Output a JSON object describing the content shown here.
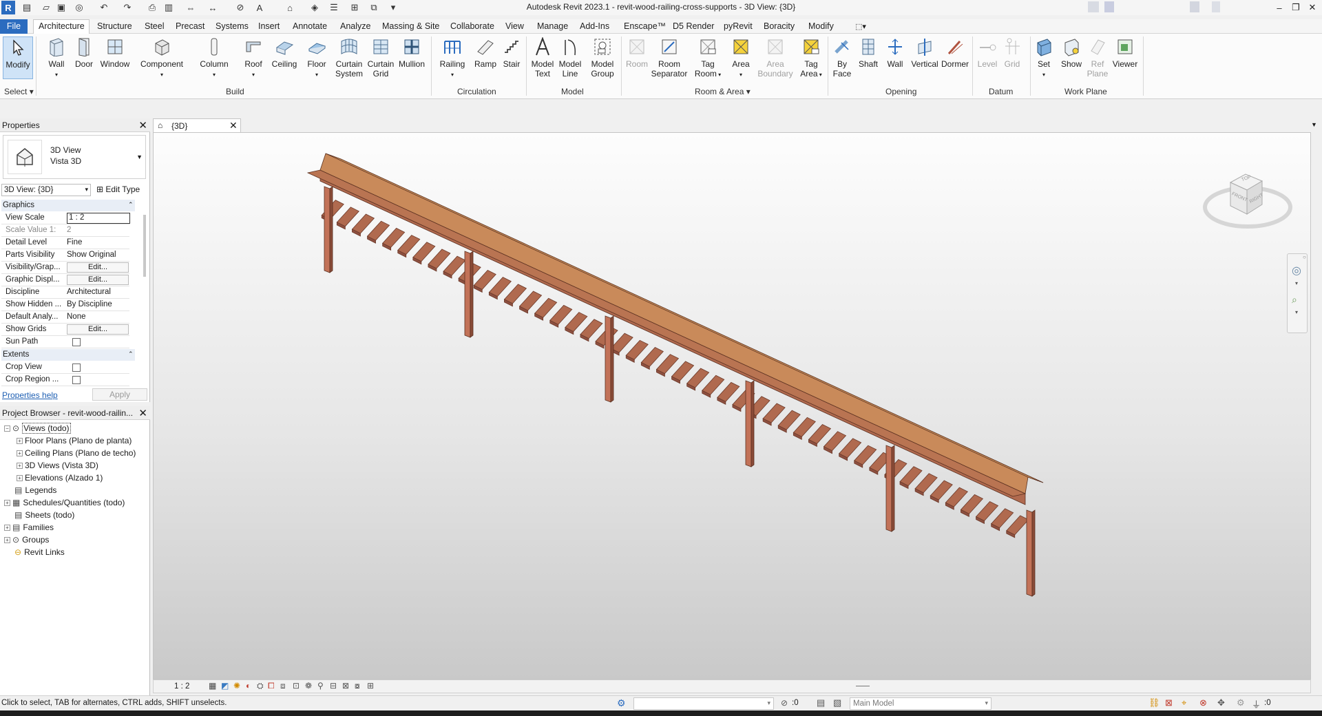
{
  "app": {
    "title": "Autodesk Revit 2023.1 - revit-wood-railing-cross-supports - 3D View: {3D}"
  },
  "menu": {
    "file": "File",
    "tabs": [
      "Architecture",
      "Structure",
      "Steel",
      "Precast",
      "Systems",
      "Insert",
      "Annotate",
      "Analyze",
      "Massing & Site",
      "Collaborate",
      "View",
      "Manage",
      "Add-Ins",
      "Enscape™",
      "D5 Render",
      "pyRevit",
      "Boracity",
      "Modify"
    ],
    "active_tab": "Architecture"
  },
  "ribbon": {
    "select": {
      "modify": "Modify",
      "select_label": "Select"
    },
    "build": {
      "label": "Build",
      "wall": "Wall",
      "door": "Door",
      "window": "Window",
      "component": "Component",
      "column": "Column",
      "roof": "Roof",
      "ceiling": "Ceiling",
      "floor": "Floor",
      "curtain_system_1": "Curtain",
      "curtain_system_2": "System",
      "curtain_grid_1": "Curtain",
      "curtain_grid_2": "Grid",
      "mullion": "Mullion"
    },
    "circulation": {
      "label": "Circulation",
      "railing": "Railing",
      "ramp": "Ramp",
      "stair": "Stair"
    },
    "model": {
      "label": "Model",
      "model_text_1": "Model",
      "model_text_2": "Text",
      "model_line_1": "Model",
      "model_line_2": "Line",
      "model_group_1": "Model",
      "model_group_2": "Group"
    },
    "room_area": {
      "label": "Room & Area",
      "room": "Room",
      "room_sep_1": "Room",
      "room_sep_2": "Separator",
      "tag_room_1": "Tag",
      "tag_room_2": "Room",
      "area": "Area",
      "area_boundary_1": "Area",
      "area_boundary_2": "Boundary",
      "tag_area_1": "Tag",
      "tag_area_2": "Area"
    },
    "opening": {
      "label": "Opening",
      "by_face_1": "By",
      "by_face_2": "Face",
      "shaft": "Shaft",
      "wall": "Wall",
      "vertical": "Vertical",
      "dormer": "Dormer"
    },
    "datum": {
      "label": "Datum",
      "level": "Level",
      "grid": "Grid"
    },
    "work_plane": {
      "label": "Work Plane",
      "set": "Set",
      "show": "Show",
      "ref_plane_1": "Ref",
      "ref_plane_2": "Plane",
      "viewer": "Viewer"
    }
  },
  "properties": {
    "header": "Properties",
    "type_1": "3D View",
    "type_2": "Vista 3D",
    "selector": "3D View: {3D}",
    "edit_type": "Edit Type",
    "group_graphics": "Graphics",
    "rows": [
      {
        "k": "View Scale",
        "v": "1 : 2"
      },
      {
        "k": "Scale Value    1:",
        "v": "2"
      },
      {
        "k": "Detail Level",
        "v": "Fine"
      },
      {
        "k": "Parts Visibility",
        "v": "Show Original"
      },
      {
        "k": "Visibility/Grap...",
        "v": "Edit..."
      },
      {
        "k": "Graphic Displ...",
        "v": "Edit..."
      },
      {
        "k": "Discipline",
        "v": "Architectural"
      },
      {
        "k": "Show Hidden ...",
        "v": "By Discipline"
      },
      {
        "k": "Default Analy...",
        "v": "None"
      },
      {
        "k": "Show Grids",
        "v": "Edit..."
      },
      {
        "k": "Sun Path",
        "v": ""
      }
    ],
    "group_extents": "Extents",
    "extent_rows": [
      {
        "k": "Crop View",
        "v": ""
      },
      {
        "k": "Crop Region ...",
        "v": ""
      }
    ],
    "help": "Properties help",
    "apply": "Apply"
  },
  "browser": {
    "header": "Project Browser - revit-wood-railin...",
    "nodes": [
      {
        "label": "Views (todo)"
      },
      {
        "label": "Floor Plans (Plano de planta)"
      },
      {
        "label": "Ceiling Plans (Plano de techo)"
      },
      {
        "label": "3D Views (Vista 3D)"
      },
      {
        "label": "Elevations (Alzado 1)"
      },
      {
        "label": "Legends"
      },
      {
        "label": "Schedules/Quantities (todo)"
      },
      {
        "label": "Sheets (todo)"
      },
      {
        "label": "Families"
      },
      {
        "label": "Groups"
      },
      {
        "label": "Revit Links"
      }
    ]
  },
  "viewtab": {
    "label": "{3D}"
  },
  "viewcube": {
    "top": "TOP",
    "front": "FRONT",
    "right": "RIGHT"
  },
  "viewbar": {
    "scale": "1 : 2"
  },
  "status": {
    "hint": "Click to select, TAB for alternates, CTRL adds, SHIFT unselects.",
    "count": ":0",
    "model": "Main Model",
    "filter": ":0"
  },
  "colors": {
    "wood_top": "#c98a5a",
    "wood_side": "#b06a4f",
    "accent": "#2b6cbf"
  }
}
